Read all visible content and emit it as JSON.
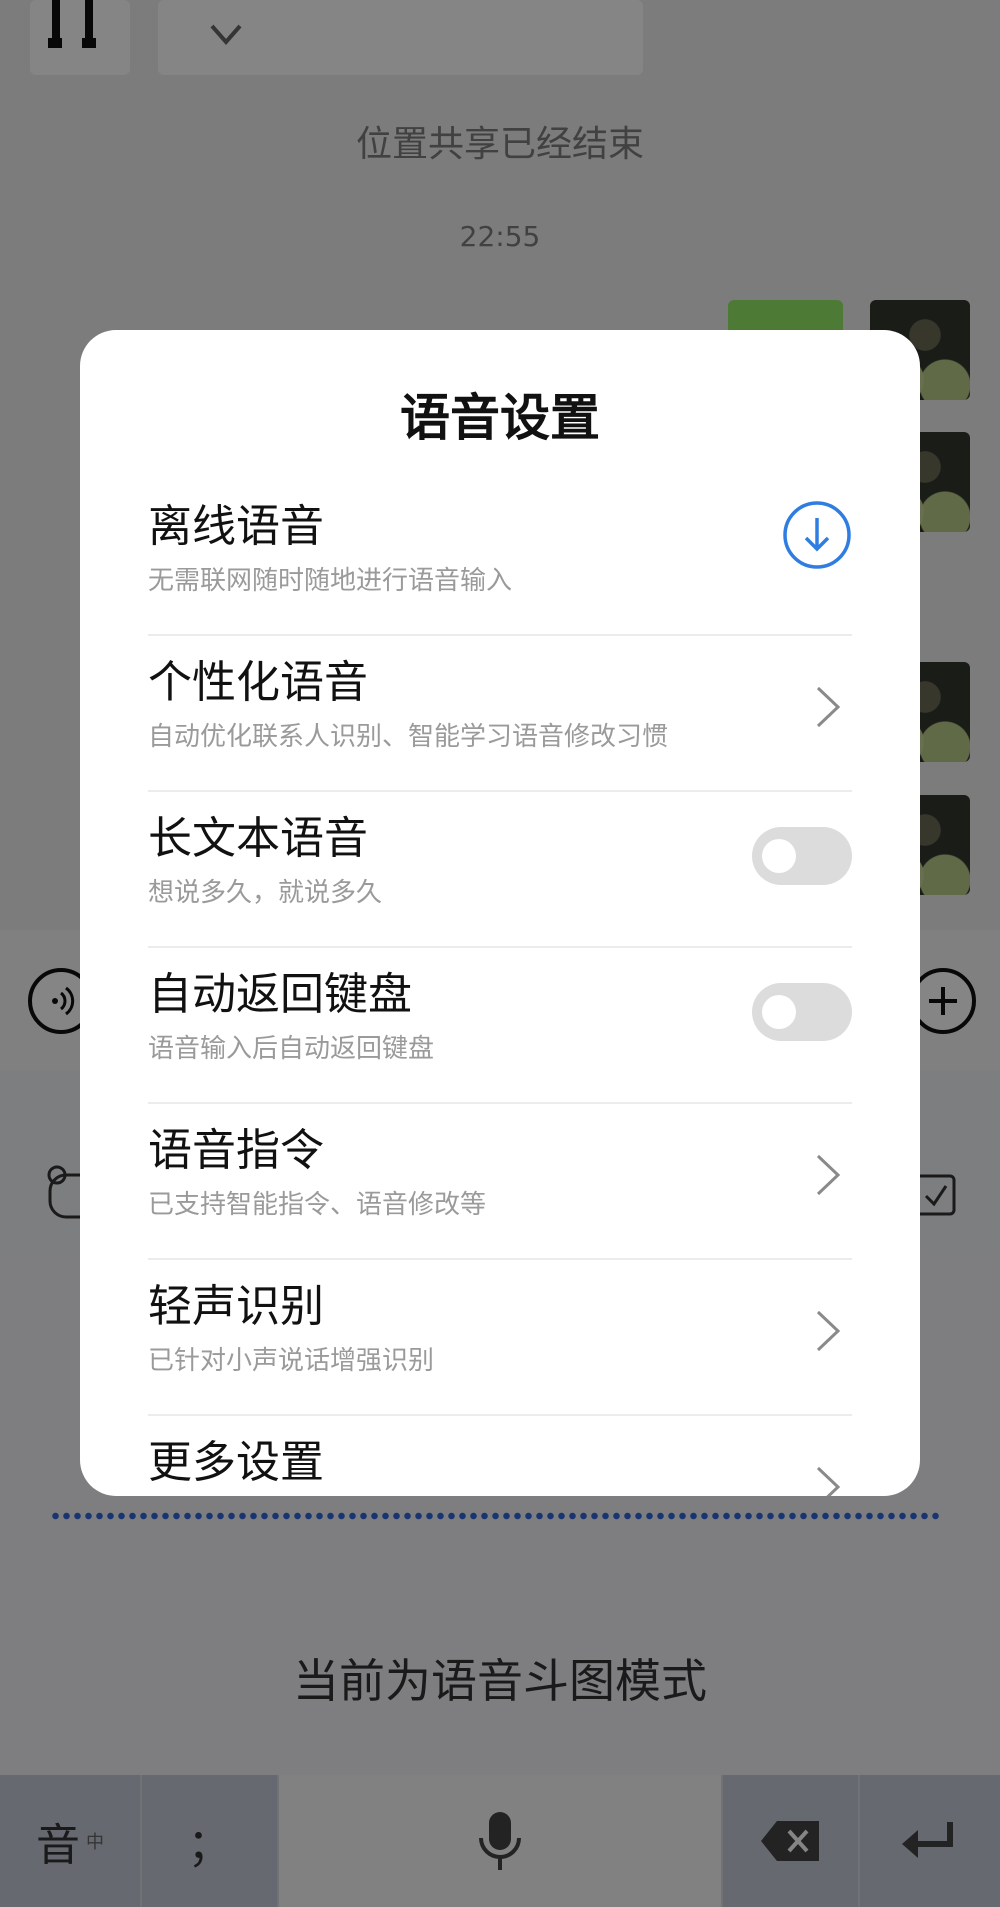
{
  "chat": {
    "location_message": "位置共享已经结束",
    "timestamp": "22:55"
  },
  "dialog": {
    "title": "语音设置",
    "items": [
      {
        "label": "离线语音",
        "subtitle": "无需联网随时随地进行语音输入",
        "control": "download-icon"
      },
      {
        "label": "个性化语音",
        "subtitle": "自动优化联系人识别、智能学习语音修改习惯",
        "control": "chevron-right-icon"
      },
      {
        "label": "长文本语音",
        "subtitle": "想说多久，就说多久",
        "control": "toggle",
        "toggle_on": false
      },
      {
        "label": "自动返回键盘",
        "subtitle": "语音输入后自动返回键盘",
        "control": "toggle",
        "toggle_on": false
      },
      {
        "label": "语音指令",
        "subtitle": "已支持智能指令、语音修改等",
        "control": "chevron-right-icon"
      },
      {
        "label": "轻声识别",
        "subtitle": "已针对小声说话增强识别",
        "control": "chevron-right-icon"
      },
      {
        "label": "更多设置",
        "subtitle": "",
        "control": "chevron-right-icon"
      }
    ]
  },
  "keyboard": {
    "mode_text": "当前为语音斗图模式",
    "key_lang": "音",
    "key_lang_small": "中",
    "key_punct": "；"
  },
  "colors": {
    "accent": "#2f7de1",
    "wave_dots": "#2f66d8",
    "overlay": "rgba(0,0,0,0.48)"
  }
}
